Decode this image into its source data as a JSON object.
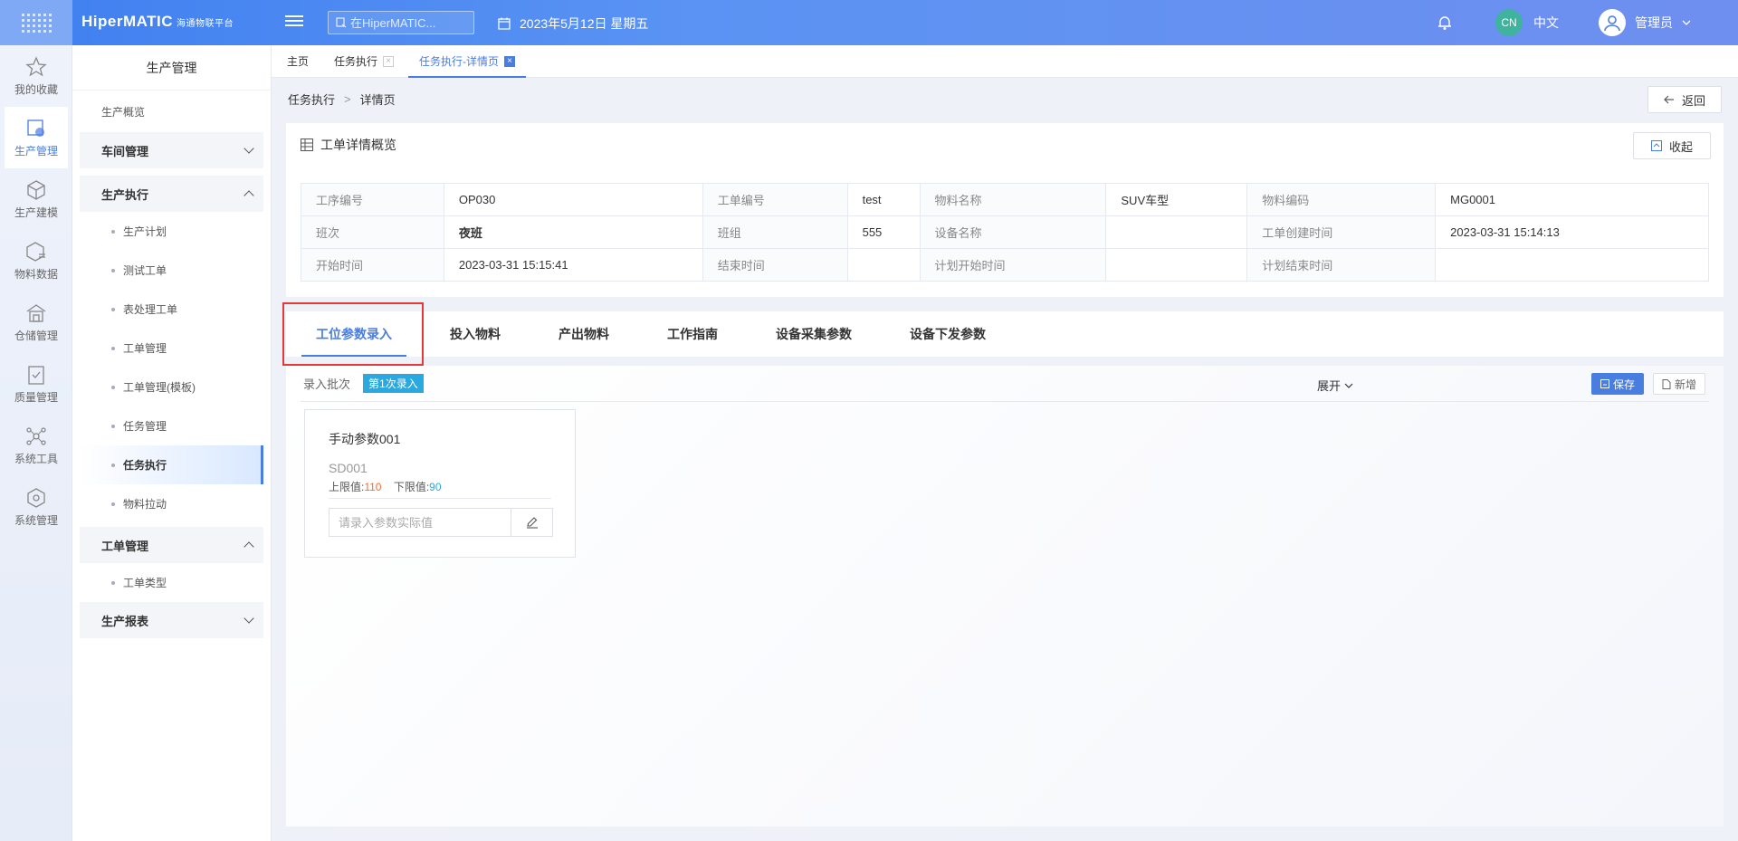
{
  "app": {
    "logo": "HiperMATIC",
    "logo_sub": "海通物联平台",
    "search_placeholder": "在HiperMATIC...",
    "date": "2023年5月12日 星期五",
    "lang_badge": "CN",
    "lang_label": "中文",
    "user": "管理员"
  },
  "iconnav": [
    {
      "label": "我的收藏",
      "icon": "star-icon"
    },
    {
      "label": "生产管理",
      "icon": "production-icon"
    },
    {
      "label": "生产建模",
      "icon": "cube-icon"
    },
    {
      "label": "物料数据",
      "icon": "material-icon"
    },
    {
      "label": "仓储管理",
      "icon": "warehouse-icon"
    },
    {
      "label": "质量管理",
      "icon": "quality-icon"
    },
    {
      "label": "系统工具",
      "icon": "tools-icon"
    },
    {
      "label": "系统管理",
      "icon": "settings-icon"
    }
  ],
  "submenu": {
    "title": "生产管理",
    "overview": "生产概览",
    "workshop": "车间管理",
    "exec_group": "生产执行",
    "exec_items": [
      "生产计划",
      "测试工单",
      "表处理工单",
      "工单管理",
      "工单管理(模板)",
      "任务管理",
      "任务执行",
      "物料拉动"
    ],
    "order_group": "工单管理",
    "order_items": [
      "工单类型"
    ],
    "report_group": "生产报表"
  },
  "tabs": {
    "home": "主页",
    "task": "任务执行",
    "detail": "任务执行-详情页"
  },
  "breadcrumb": {
    "parent": "任务执行",
    "sep": ">",
    "current": "详情页"
  },
  "back_label": "返回",
  "overview": {
    "title": "工单详情概览",
    "collapse_label": "收起",
    "rows": [
      [
        [
          "工序编号",
          "OP030"
        ],
        [
          "工单编号",
          "test"
        ],
        [
          "物料名称",
          "SUV车型"
        ],
        [
          "物料编码",
          "MG0001"
        ]
      ],
      [
        [
          "班次",
          "夜班"
        ],
        [
          "班组",
          "555"
        ],
        [
          "设备名称",
          ""
        ],
        [
          "工单创建时间",
          "2023-03-31 15:14:13"
        ]
      ],
      [
        [
          "开始时间",
          "2023-03-31 15:15:41"
        ],
        [
          "结束时间",
          ""
        ],
        [
          "计划开始时间",
          ""
        ],
        [
          "计划结束时间",
          ""
        ]
      ]
    ]
  },
  "detail_tabs": [
    "工位参数录入",
    "投入物料",
    "产出物料",
    "工作指南",
    "设备采集参数",
    "设备下发参数"
  ],
  "batch": {
    "label": "录入批次",
    "tag": "第1次录入",
    "expand": "展开",
    "save": "保存",
    "add": "新增"
  },
  "param": {
    "name": "手动参数001",
    "code": "SD001",
    "upper_label": "上限值:",
    "upper_value": "110",
    "lower_label": "下限值:",
    "lower_value": "90",
    "input_placeholder": "请录入参数实际值"
  }
}
